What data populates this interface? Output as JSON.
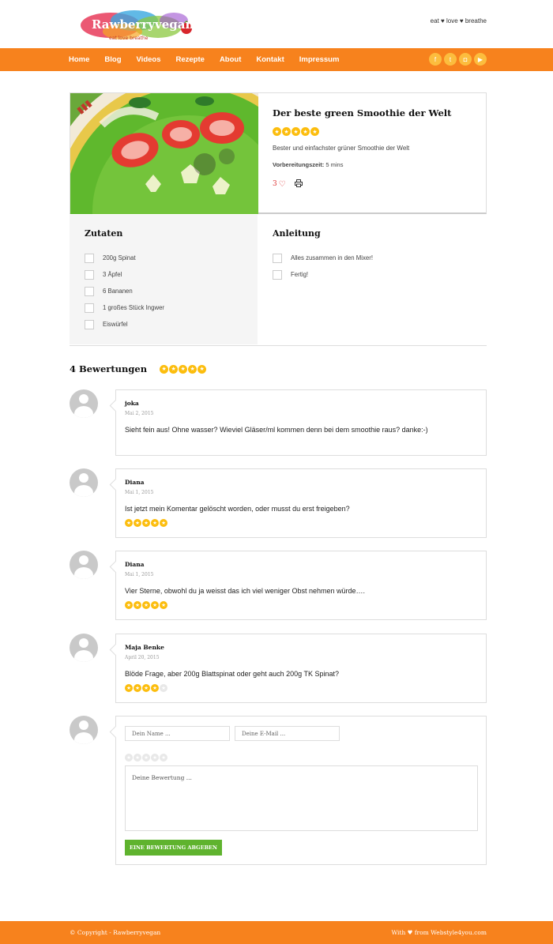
{
  "header": {
    "logo_text": "Rawberryvegan",
    "logo_sub": "eat love breathe",
    "tagline": "eat ♥ love ♥ breathe"
  },
  "nav": {
    "items": [
      {
        "label": "Home"
      },
      {
        "label": "Blog"
      },
      {
        "label": "Videos"
      },
      {
        "label": "Rezepte"
      },
      {
        "label": "About"
      },
      {
        "label": "Kontakt"
      },
      {
        "label": "Impressum"
      }
    ],
    "social": [
      {
        "icon": "facebook-icon",
        "glyph": "f"
      },
      {
        "icon": "twitter-icon",
        "glyph": "t"
      },
      {
        "icon": "instagram-icon",
        "glyph": "◘"
      },
      {
        "icon": "youtube-icon",
        "glyph": "▶"
      }
    ]
  },
  "recipe": {
    "title": "Der beste green Smoothie der Welt",
    "rating": 5,
    "description": "Bester und einfachster grüner Smoothie der Welt",
    "prep_label": "Vorbereitungszeit:",
    "prep_value": "5 mins",
    "likes": "3"
  },
  "ingredients": {
    "title": "Zutaten",
    "items": [
      "200g Spinat",
      "3 Äpfel",
      "6 Bananen",
      "1 großes Stück Ingwer",
      "Eiswürfel"
    ]
  },
  "instructions": {
    "title": "Anleitung",
    "items": [
      "Alles zusammen in den Mixer!",
      "Fertig!"
    ]
  },
  "reviews": {
    "title": "4 Bewertungen",
    "average": 5,
    "comments": [
      {
        "author": "joka",
        "date": "Mai 2, 2015",
        "text": "Sieht fein aus! Ohne wasser? Wieviel Gläser/ml kommen denn bei dem smoothie raus? danke:-)",
        "rating": 0
      },
      {
        "author": "Diana",
        "date": "Mai 1, 2015",
        "text": "Ist jetzt mein Komentar gelöscht worden, oder musst du erst freigeben?",
        "rating": 5
      },
      {
        "author": "Diana",
        "date": "Mai 1, 2015",
        "text": "Vier Sterne, obwohl du ja weisst das ich viel weniger Obst nehmen würde….",
        "rating": 5
      },
      {
        "author": "Maja Benke",
        "date": "April 20, 2015",
        "text": "Blöde Frage, aber 200g Blattspinat oder geht auch 200g TK Spinat?",
        "rating": 4
      }
    ]
  },
  "form": {
    "name_placeholder": "Dein Name ...",
    "email_placeholder": "Deine E-Mail ...",
    "review_placeholder": "Deine Bewertung ...",
    "submit_label": "Eine Bewertung abgeben"
  },
  "footer": {
    "copyright": "© Copyright - Rawberryvegan",
    "credit": "With ♥ from Webstyle4you.com"
  },
  "colors": {
    "brand_orange": "#f7821d",
    "star_yellow": "#fcbd0d",
    "submit_green": "#5fb32e"
  }
}
